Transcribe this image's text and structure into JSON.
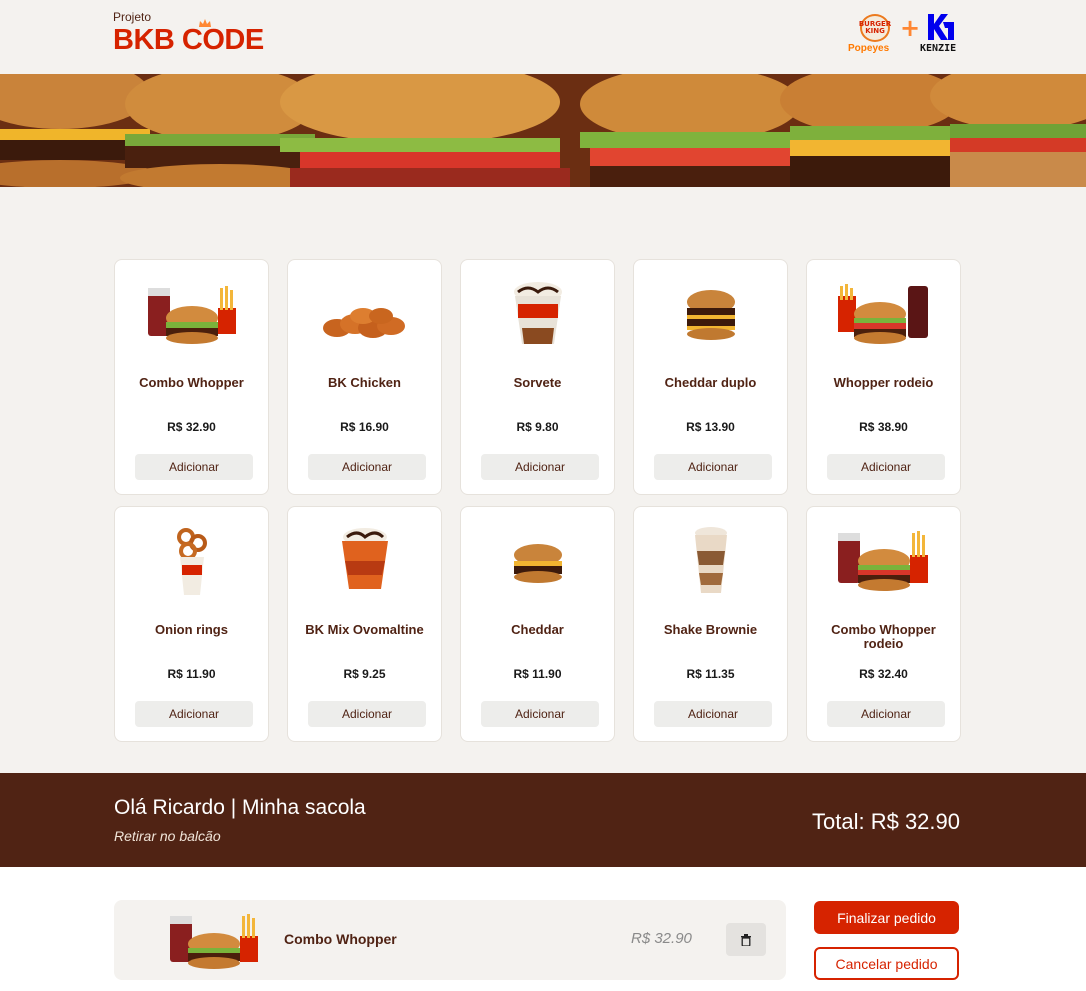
{
  "header": {
    "logo_small": "Projeto",
    "logo_big": "BKB CODE",
    "partner_bk": "BURGER KING",
    "partner_popeyes": "Popeyes",
    "partner_plus": "+",
    "partner_kenzie": "KENZIE"
  },
  "products": [
    {
      "name": "Combo Whopper",
      "price": "R$ 32.90",
      "button": "Adicionar",
      "icon": "combo-icon"
    },
    {
      "name": "BK Chicken",
      "price": "R$ 16.90",
      "button": "Adicionar",
      "icon": "chicken-icon"
    },
    {
      "name": "Sorvete",
      "price": "R$ 9.80",
      "button": "Adicionar",
      "icon": "sundae-icon"
    },
    {
      "name": "Cheddar duplo",
      "price": "R$ 13.90",
      "button": "Adicionar",
      "icon": "double-burger-icon"
    },
    {
      "name": "Whopper rodeio",
      "price": "R$ 38.90",
      "button": "Adicionar",
      "icon": "combo-icon"
    },
    {
      "name": "Onion rings",
      "price": "R$ 11.90",
      "button": "Adicionar",
      "icon": "onion-rings-icon"
    },
    {
      "name": "BK Mix Ovomaltine",
      "price": "R$ 9.25",
      "button": "Adicionar",
      "icon": "sundae-icon"
    },
    {
      "name": "Cheddar",
      "price": "R$ 11.90",
      "button": "Adicionar",
      "icon": "burger-icon"
    },
    {
      "name": "Shake Brownie",
      "price": "R$ 11.35",
      "button": "Adicionar",
      "icon": "shake-icon"
    },
    {
      "name": "Combo Whopper rodeio",
      "price": "R$ 32.40",
      "button": "Adicionar",
      "icon": "combo-icon"
    }
  ],
  "bag": {
    "title": "Olá Ricardo | Minha sacola",
    "subtitle": "Retirar no balcão",
    "total": "Total: R$ 32.90",
    "items": [
      {
        "name": "Combo Whopper",
        "price": "R$ 32.90"
      }
    ],
    "finalize_label": "Finalizar pedido",
    "cancel_label": "Cancelar pedido"
  },
  "colors": {
    "brand_red": "#d62300",
    "brand_brown": "#502314",
    "background": "#f4f2ef"
  }
}
